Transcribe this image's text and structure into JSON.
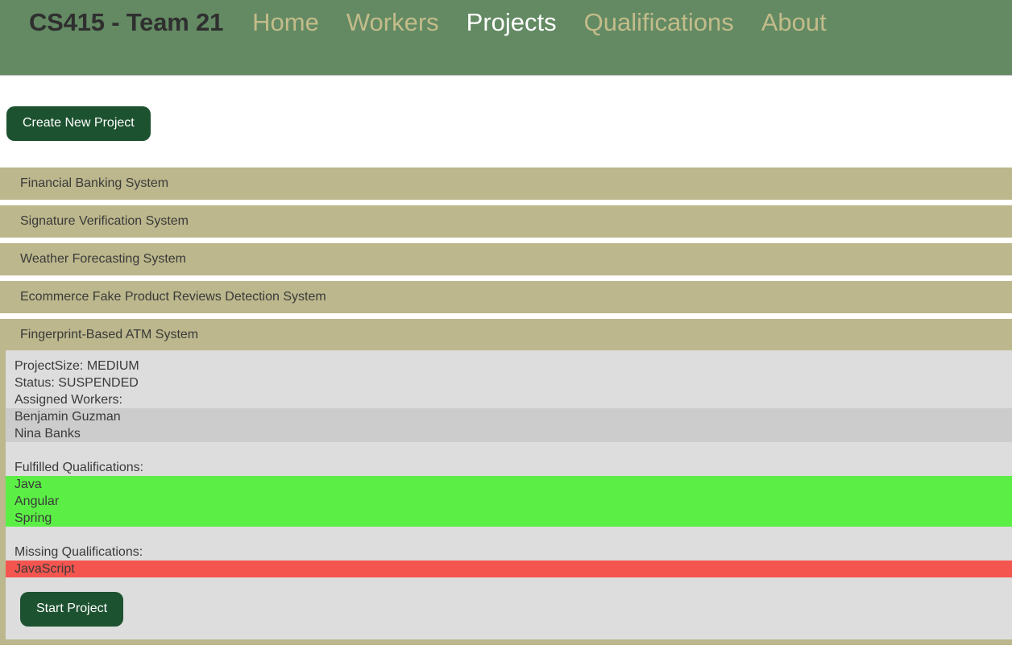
{
  "navbar": {
    "brand": "CS415 - Team 21",
    "links": [
      {
        "label": "Home",
        "active": false
      },
      {
        "label": "Workers",
        "active": false
      },
      {
        "label": "Projects",
        "active": true
      },
      {
        "label": "Qualifications",
        "active": false
      },
      {
        "label": "About",
        "active": false
      }
    ],
    "background_color": "#638a63",
    "link_color": "#c3bc8a",
    "active_link_color": "#ffffff"
  },
  "toolbar": {
    "create_label": "Create New Project",
    "button_color": "#1d5230"
  },
  "projects": [
    {
      "name": "Financial Banking System",
      "expanded": false
    },
    {
      "name": "Signature Verification System",
      "expanded": false
    },
    {
      "name": "Weather Forecasting System",
      "expanded": false
    },
    {
      "name": "Ecommerce Fake Product Reviews Detection System",
      "expanded": false
    },
    {
      "name": "Fingerprint-Based ATM System",
      "expanded": true
    }
  ],
  "detail": {
    "project_size_line": "ProjectSize: MEDIUM",
    "status_line": "Status: SUSPENDED",
    "assigned_workers_label": "Assigned Workers:",
    "assigned_workers": [
      "Benjamin Guzman",
      "Nina Banks"
    ],
    "fulfilled_label": "Fulfilled Qualifications:",
    "fulfilled": [
      "Java",
      "Angular",
      "Spring"
    ],
    "missing_label": "Missing Qualifications:",
    "missing": [
      "JavaScript"
    ],
    "start_label": "Start Project",
    "header_color": "#bcb78c",
    "panel_color": "#dddddd",
    "workers_band_color": "#cccccc",
    "fulfilled_color": "#5bef45",
    "missing_color": "#f5554f"
  }
}
